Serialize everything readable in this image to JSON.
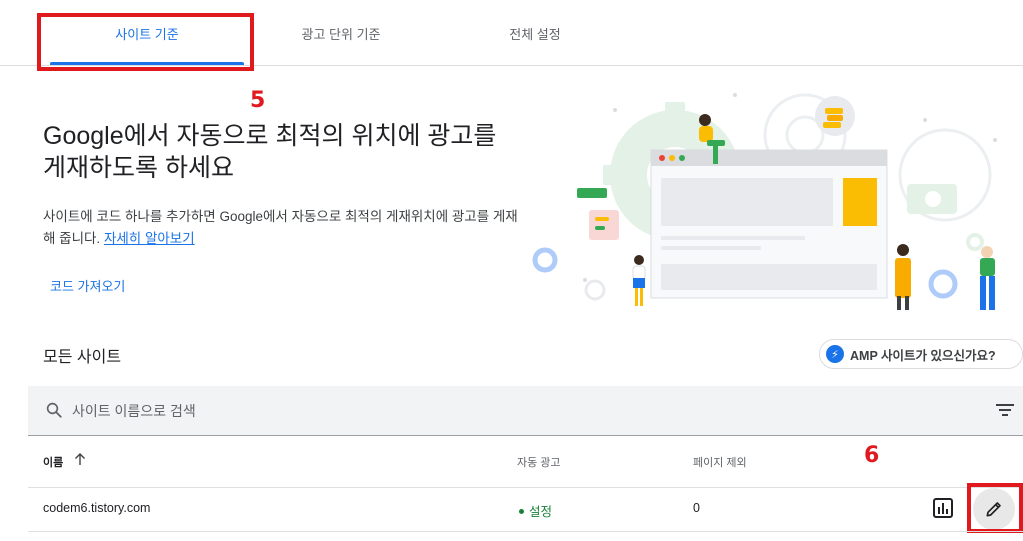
{
  "tabs": [
    {
      "label": "사이트 기준",
      "active": true
    },
    {
      "label": "광고 단위 기준",
      "active": false
    },
    {
      "label": "전체 설정",
      "active": false
    }
  ],
  "annotations": {
    "tab_marker": "5",
    "edit_marker": "6",
    "color": "#e0191f"
  },
  "hero": {
    "title": "Google에서 자동으로 최적의 위치에 광고를 게재하도록 하세요",
    "description": "사이트에 코드 하나를 추가하면 Google에서 자동으로 최적의 게재위치에 광고를 게재해 줍니다.",
    "learn_more": "자세히 알아보기",
    "get_code": "코드 가져오기"
  },
  "sites": {
    "title": "모든 사이트",
    "amp_button": "AMP 사이트가 있으신가요?",
    "search_placeholder": "사이트 이름으로 검색",
    "columns": {
      "name": "이름",
      "auto_ads": "자동 광고",
      "page_exclusions": "페이지 제외"
    },
    "rows": [
      {
        "name": "codem6.tistory.com",
        "auto_ads": "설정",
        "page_exclusions": "0"
      }
    ]
  },
  "icons": [
    "search-icon",
    "filter-icon",
    "sort-arrow-up-icon",
    "bar-chart-icon",
    "pencil-icon",
    "amp-bolt-icon"
  ],
  "colors": {
    "accent": "#1a73e8",
    "status_on": "#188038",
    "annotation": "#e0191f"
  }
}
